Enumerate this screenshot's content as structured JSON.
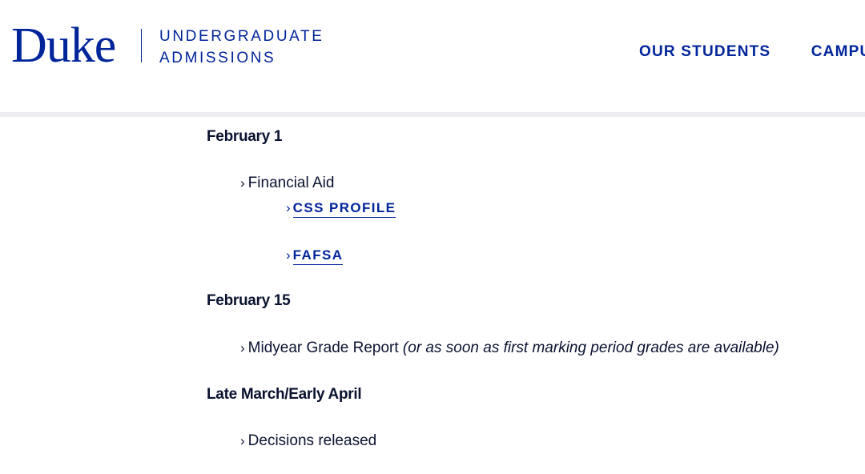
{
  "header": {
    "logo_word": "Duke",
    "logo_sub_line1": "UNDERGRADUATE",
    "logo_sub_line2": "ADMISSIONS",
    "nav": [
      "OUR STUDENTS",
      "CAMPU"
    ]
  },
  "timeline": [
    {
      "date": "February 1",
      "item": "Financial Aid",
      "links": [
        "CSS PROFILE",
        "FAFSA"
      ]
    },
    {
      "date": "February 15",
      "item": "Midyear Grade Report",
      "note": "(or as soon as first marking period grades are available)"
    },
    {
      "date": "Late March/Early April",
      "item": "Decisions released"
    }
  ],
  "colors": {
    "brand_blue": "#00249a",
    "text_dark": "#0a1230",
    "divider": "#ececf1"
  },
  "icons": {
    "bullet": "chevron-right-icon"
  }
}
